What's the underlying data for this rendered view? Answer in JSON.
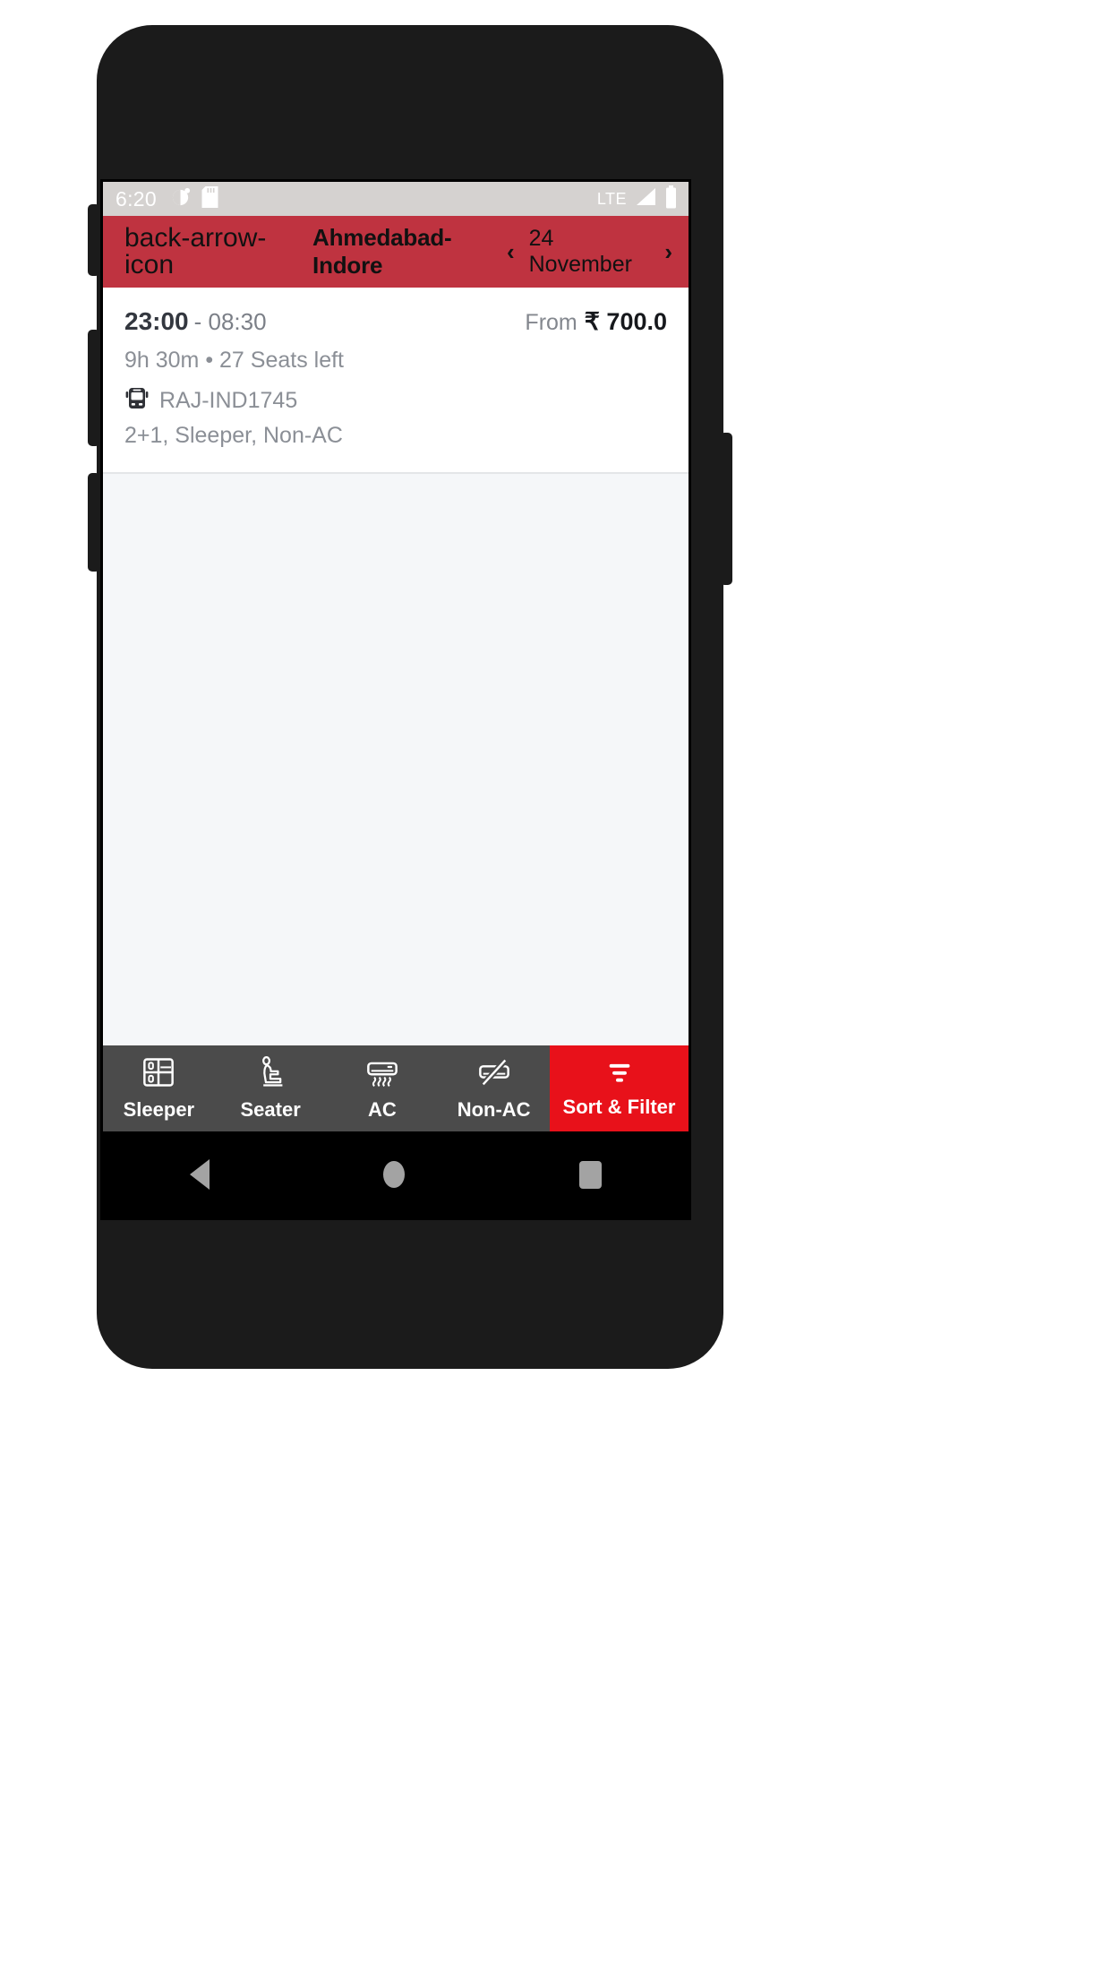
{
  "status_bar": {
    "time": "6:20",
    "network": "LTE",
    "icons": [
      "do-not-disturb-icon",
      "sd-card-icon",
      "signal-icon",
      "battery-icon"
    ]
  },
  "app_bar": {
    "back_icon": "back-arrow-icon",
    "route_title": "Ahmedabad-Indore",
    "prev_icon": "‹",
    "date": "24 November",
    "next_icon": "›"
  },
  "results": [
    {
      "depart_time": "23:00",
      "arrive_time": "- 08:30",
      "fare_prefix": "From",
      "fare_amount": "₹ 700.0",
      "duration_seats": "9h 30m  •  27 Seats left",
      "bus_icon": "bus-icon",
      "bus_name": "RAJ-IND1745",
      "bus_attributes": "2+1, Sleeper, Non-AC"
    }
  ],
  "filter_bar": {
    "items": [
      {
        "label": "Sleeper",
        "icon": "sleeper-berth-icon"
      },
      {
        "label": "Seater",
        "icon": "seat-icon"
      },
      {
        "label": "AC",
        "icon": "air-conditioner-icon"
      },
      {
        "label": "Non-AC",
        "icon": "air-conditioner-off-icon"
      },
      {
        "label": "Sort & Filter",
        "icon": "filter-funnel-icon"
      }
    ]
  },
  "nav_bar": {
    "back": "nav-back-icon",
    "home": "nav-home-icon",
    "recents": "nav-recents-icon"
  },
  "colors": {
    "app_bar_red": "#bf3340",
    "sort_filter_red": "#e8111a",
    "filter_bar_gray": "#4b4b4b",
    "status_bar_gray": "#d5d2d0",
    "page_background": "#f5f7f9"
  }
}
